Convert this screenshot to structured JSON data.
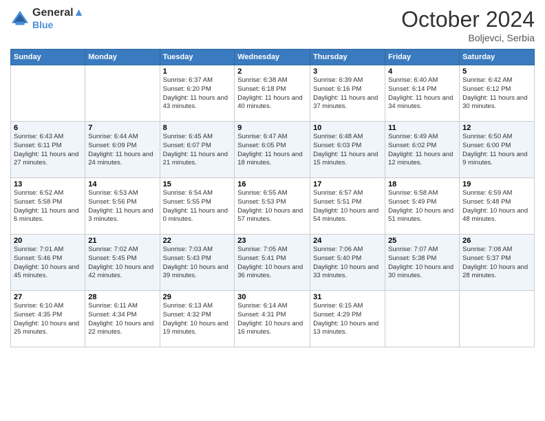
{
  "header": {
    "logo_line1": "General",
    "logo_line2": "Blue",
    "month_title": "October 2024",
    "location": "Boljevci, Serbia"
  },
  "weekdays": [
    "Sunday",
    "Monday",
    "Tuesday",
    "Wednesday",
    "Thursday",
    "Friday",
    "Saturday"
  ],
  "weeks": [
    [
      {
        "day": "",
        "sunrise": "",
        "sunset": "",
        "daylight": ""
      },
      {
        "day": "",
        "sunrise": "",
        "sunset": "",
        "daylight": ""
      },
      {
        "day": "1",
        "sunrise": "Sunrise: 6:37 AM",
        "sunset": "Sunset: 6:20 PM",
        "daylight": "Daylight: 11 hours and 43 minutes."
      },
      {
        "day": "2",
        "sunrise": "Sunrise: 6:38 AM",
        "sunset": "Sunset: 6:18 PM",
        "daylight": "Daylight: 11 hours and 40 minutes."
      },
      {
        "day": "3",
        "sunrise": "Sunrise: 6:39 AM",
        "sunset": "Sunset: 6:16 PM",
        "daylight": "Daylight: 11 hours and 37 minutes."
      },
      {
        "day": "4",
        "sunrise": "Sunrise: 6:40 AM",
        "sunset": "Sunset: 6:14 PM",
        "daylight": "Daylight: 11 hours and 34 minutes."
      },
      {
        "day": "5",
        "sunrise": "Sunrise: 6:42 AM",
        "sunset": "Sunset: 6:12 PM",
        "daylight": "Daylight: 11 hours and 30 minutes."
      }
    ],
    [
      {
        "day": "6",
        "sunrise": "Sunrise: 6:43 AM",
        "sunset": "Sunset: 6:11 PM",
        "daylight": "Daylight: 11 hours and 27 minutes."
      },
      {
        "day": "7",
        "sunrise": "Sunrise: 6:44 AM",
        "sunset": "Sunset: 6:09 PM",
        "daylight": "Daylight: 11 hours and 24 minutes."
      },
      {
        "day": "8",
        "sunrise": "Sunrise: 6:45 AM",
        "sunset": "Sunset: 6:07 PM",
        "daylight": "Daylight: 11 hours and 21 minutes."
      },
      {
        "day": "9",
        "sunrise": "Sunrise: 6:47 AM",
        "sunset": "Sunset: 6:05 PM",
        "daylight": "Daylight: 11 hours and 18 minutes."
      },
      {
        "day": "10",
        "sunrise": "Sunrise: 6:48 AM",
        "sunset": "Sunset: 6:03 PM",
        "daylight": "Daylight: 11 hours and 15 minutes."
      },
      {
        "day": "11",
        "sunrise": "Sunrise: 6:49 AM",
        "sunset": "Sunset: 6:02 PM",
        "daylight": "Daylight: 11 hours and 12 minutes."
      },
      {
        "day": "12",
        "sunrise": "Sunrise: 6:50 AM",
        "sunset": "Sunset: 6:00 PM",
        "daylight": "Daylight: 11 hours and 9 minutes."
      }
    ],
    [
      {
        "day": "13",
        "sunrise": "Sunrise: 6:52 AM",
        "sunset": "Sunset: 5:58 PM",
        "daylight": "Daylight: 11 hours and 6 minutes."
      },
      {
        "day": "14",
        "sunrise": "Sunrise: 6:53 AM",
        "sunset": "Sunset: 5:56 PM",
        "daylight": "Daylight: 11 hours and 3 minutes."
      },
      {
        "day": "15",
        "sunrise": "Sunrise: 6:54 AM",
        "sunset": "Sunset: 5:55 PM",
        "daylight": "Daylight: 11 hours and 0 minutes."
      },
      {
        "day": "16",
        "sunrise": "Sunrise: 6:55 AM",
        "sunset": "Sunset: 5:53 PM",
        "daylight": "Daylight: 10 hours and 57 minutes."
      },
      {
        "day": "17",
        "sunrise": "Sunrise: 6:57 AM",
        "sunset": "Sunset: 5:51 PM",
        "daylight": "Daylight: 10 hours and 54 minutes."
      },
      {
        "day": "18",
        "sunrise": "Sunrise: 6:58 AM",
        "sunset": "Sunset: 5:49 PM",
        "daylight": "Daylight: 10 hours and 51 minutes."
      },
      {
        "day": "19",
        "sunrise": "Sunrise: 6:59 AM",
        "sunset": "Sunset: 5:48 PM",
        "daylight": "Daylight: 10 hours and 48 minutes."
      }
    ],
    [
      {
        "day": "20",
        "sunrise": "Sunrise: 7:01 AM",
        "sunset": "Sunset: 5:46 PM",
        "daylight": "Daylight: 10 hours and 45 minutes."
      },
      {
        "day": "21",
        "sunrise": "Sunrise: 7:02 AM",
        "sunset": "Sunset: 5:45 PM",
        "daylight": "Daylight: 10 hours and 42 minutes."
      },
      {
        "day": "22",
        "sunrise": "Sunrise: 7:03 AM",
        "sunset": "Sunset: 5:43 PM",
        "daylight": "Daylight: 10 hours and 39 minutes."
      },
      {
        "day": "23",
        "sunrise": "Sunrise: 7:05 AM",
        "sunset": "Sunset: 5:41 PM",
        "daylight": "Daylight: 10 hours and 36 minutes."
      },
      {
        "day": "24",
        "sunrise": "Sunrise: 7:06 AM",
        "sunset": "Sunset: 5:40 PM",
        "daylight": "Daylight: 10 hours and 33 minutes."
      },
      {
        "day": "25",
        "sunrise": "Sunrise: 7:07 AM",
        "sunset": "Sunset: 5:38 PM",
        "daylight": "Daylight: 10 hours and 30 minutes."
      },
      {
        "day": "26",
        "sunrise": "Sunrise: 7:08 AM",
        "sunset": "Sunset: 5:37 PM",
        "daylight": "Daylight: 10 hours and 28 minutes."
      }
    ],
    [
      {
        "day": "27",
        "sunrise": "Sunrise: 6:10 AM",
        "sunset": "Sunset: 4:35 PM",
        "daylight": "Daylight: 10 hours and 25 minutes."
      },
      {
        "day": "28",
        "sunrise": "Sunrise: 6:11 AM",
        "sunset": "Sunset: 4:34 PM",
        "daylight": "Daylight: 10 hours and 22 minutes."
      },
      {
        "day": "29",
        "sunrise": "Sunrise: 6:13 AM",
        "sunset": "Sunset: 4:32 PM",
        "daylight": "Daylight: 10 hours and 19 minutes."
      },
      {
        "day": "30",
        "sunrise": "Sunrise: 6:14 AM",
        "sunset": "Sunset: 4:31 PM",
        "daylight": "Daylight: 10 hours and 16 minutes."
      },
      {
        "day": "31",
        "sunrise": "Sunrise: 6:15 AM",
        "sunset": "Sunset: 4:29 PM",
        "daylight": "Daylight: 10 hours and 13 minutes."
      },
      {
        "day": "",
        "sunrise": "",
        "sunset": "",
        "daylight": ""
      },
      {
        "day": "",
        "sunrise": "",
        "sunset": "",
        "daylight": ""
      }
    ]
  ]
}
